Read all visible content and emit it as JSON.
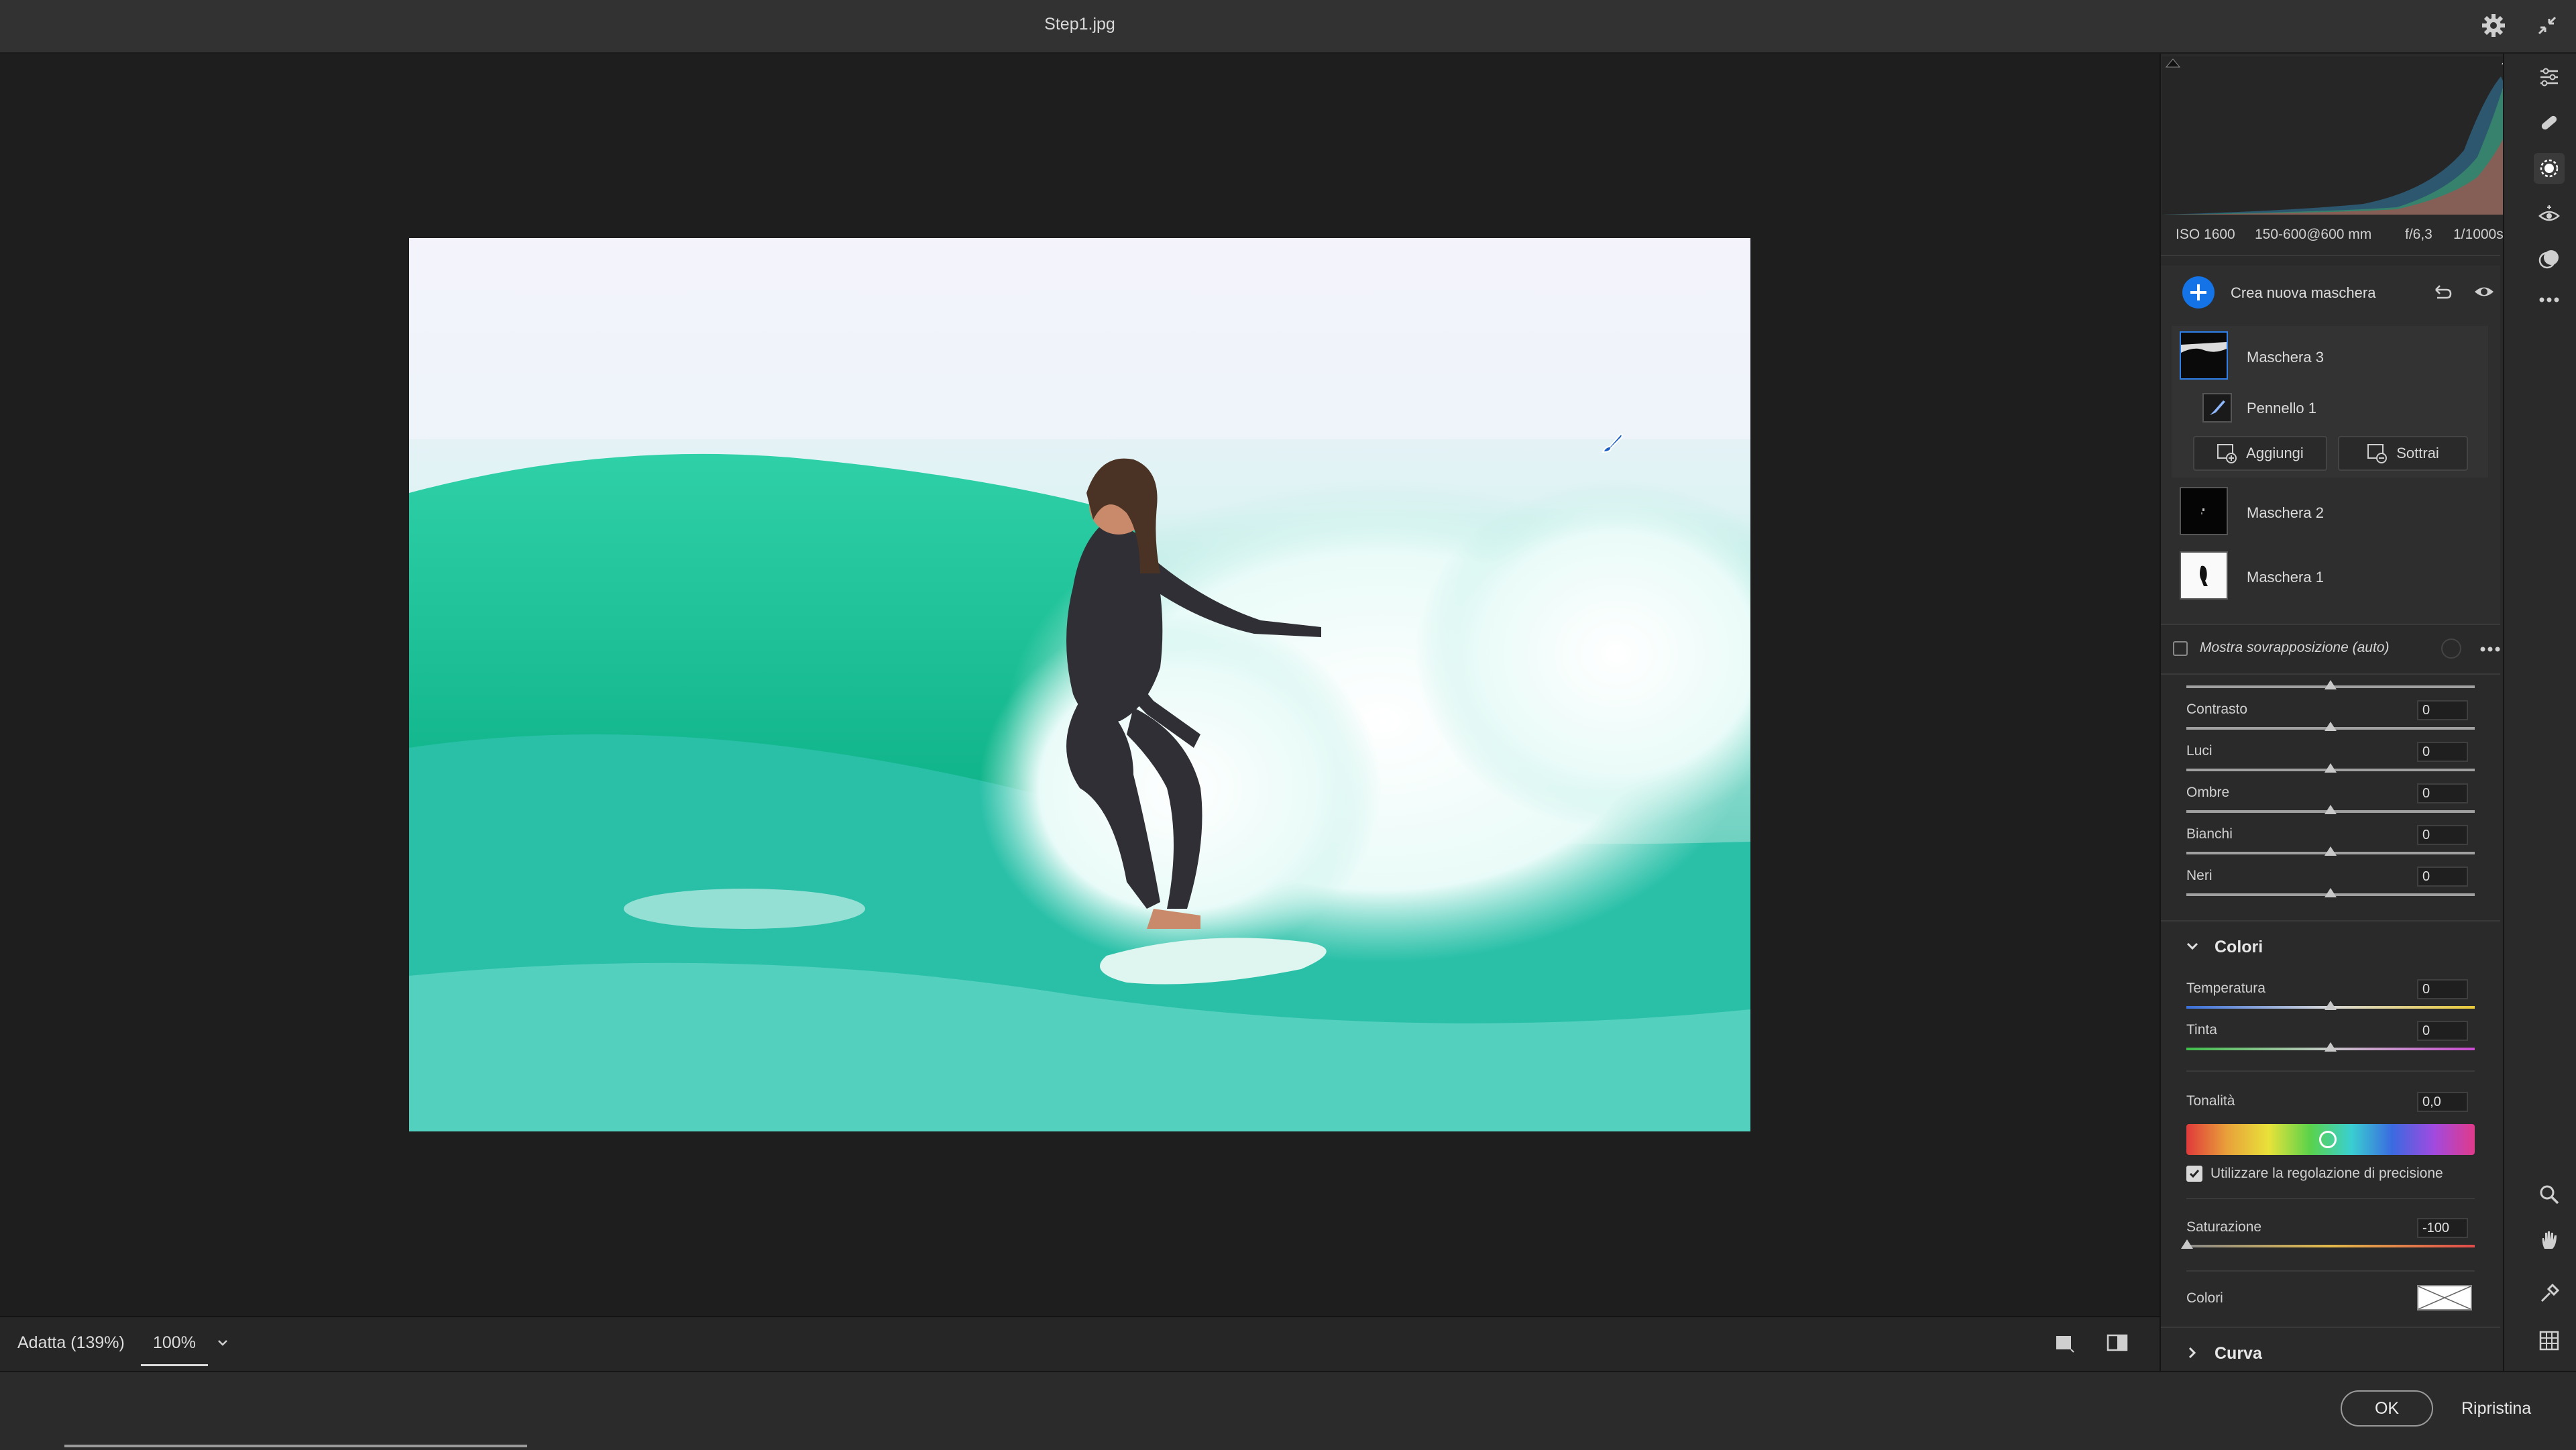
{
  "window": {
    "title": "Step1.jpg"
  },
  "histogram": {
    "iso": "ISO 1600",
    "lens": "150-600@600 mm",
    "aperture": "f/6,3",
    "shutter": "1/1000s"
  },
  "masks": {
    "create_label": "Crea nuova maschera",
    "items": [
      {
        "label": "Maschera 3",
        "selected": true
      },
      {
        "label": "Pennello 1"
      },
      {
        "label": "Maschera 2"
      },
      {
        "label": "Maschera 1"
      }
    ],
    "add_label": "Aggiungi",
    "subtract_label": "Sottrai",
    "overlay_label": "Mostra sovrapposizione (auto)"
  },
  "sliders": [
    {
      "label": "Contrasto",
      "value": "0"
    },
    {
      "label": "Luci",
      "value": "0"
    },
    {
      "label": "Ombre",
      "value": "0"
    },
    {
      "label": "Bianchi",
      "value": "0"
    },
    {
      "label": "Neri",
      "value": "0"
    }
  ],
  "colors_section": {
    "title": "Colori",
    "temperature": {
      "label": "Temperatura",
      "value": "0"
    },
    "tint": {
      "label": "Tinta",
      "value": "0"
    },
    "hue": {
      "label": "Tonalità",
      "value": "0,0"
    },
    "precision_label": "Utilizzare la regolazione di precisione",
    "precision_checked": true,
    "saturation": {
      "label": "Saturazione",
      "value": "-100"
    },
    "color_label": "Colori"
  },
  "curve_section": {
    "title": "Curva"
  },
  "zoom": {
    "fit_label": "Adatta (139%)",
    "percent_label": "100%"
  },
  "footer": {
    "ok_label": "OK",
    "reset_label": "Ripristina"
  },
  "accent_color": "#1473e6"
}
